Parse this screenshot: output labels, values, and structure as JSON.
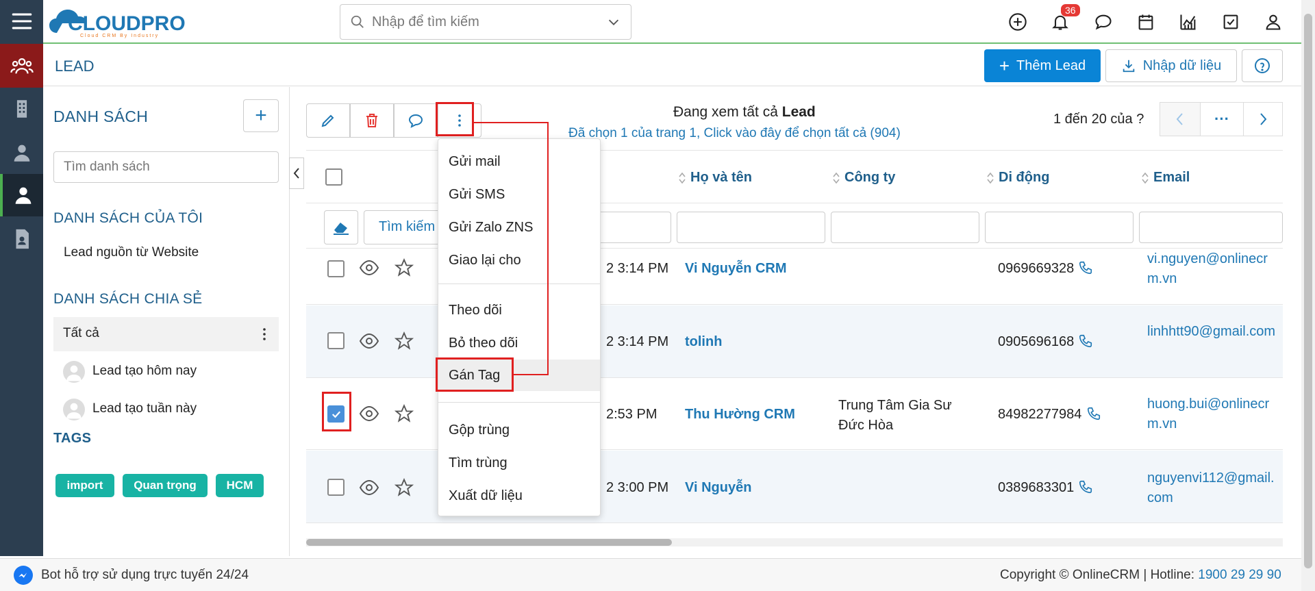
{
  "app": {
    "logo_text": "CLOUDPRO",
    "logo_tagline": "Cloud CRM By Industry"
  },
  "search": {
    "placeholder": "Nhập để tìm kiếm"
  },
  "notifications": {
    "count": "36"
  },
  "module": {
    "title": "LEAD",
    "add_button": "Thêm Lead",
    "import_button": "Nhập dữ liệu"
  },
  "lists": {
    "header": "DANH SÁCH",
    "search_placeholder": "Tìm danh sách",
    "my_lists_header": "DANH SÁCH CỦA TÔI",
    "my_lists": [
      "Lead nguồn từ Website"
    ],
    "shared_header": "DANH SÁCH CHIA SẺ",
    "shared": [
      "Tất cả",
      "Lead tạo hôm nay",
      "Lead tạo tuần này"
    ],
    "tags_header": "TAGS",
    "tags": [
      "import",
      "Quan trọng",
      "HCM"
    ]
  },
  "view": {
    "viewing_prefix": "Đang xem tất cả",
    "viewing_entity": "Lead",
    "selection_note": "Đã chọn 1 của trang 1, Click vào đây để chọn tất cả (904)",
    "pagination": "1 đến 20 của",
    "pagination_unknown": "?",
    "more_pages": "···"
  },
  "table": {
    "filter_button": "Tìm kiếm",
    "columns": [
      "Họ và tên",
      "Công ty",
      "Di động",
      "Email"
    ],
    "rows": [
      {
        "time": "2 3:14 PM",
        "name": "Vi Nguyễn CRM",
        "company": "",
        "mobile": "0969669328",
        "email": "vi.nguyen@onlinecrm.vn",
        "checked": false
      },
      {
        "time": "2 3:14 PM",
        "name": "tolinh",
        "company": "",
        "mobile": "0905696168",
        "email": "linhhtt90@gmail.com",
        "checked": false
      },
      {
        "time": "2:53 PM",
        "name": "Thu Hường CRM",
        "company": "Trung Tâm Gia Sư Đức Hòa",
        "mobile": "84982277984",
        "email": "huong.bui@onlinecrm.vn",
        "checked": true
      },
      {
        "time": "2 3:00 PM",
        "name": "Vi Nguyễn",
        "company": "",
        "mobile": "0389683301",
        "email": "nguyenvi112@gmail.com",
        "checked": false
      }
    ]
  },
  "actions_menu": {
    "items": [
      "Gửi mail",
      "Gửi SMS",
      "Gửi Zalo ZNS",
      "Giao lại cho",
      "Theo dõi",
      "Bỏ theo dõi",
      "Gán Tag",
      "Gộp trùng",
      "Tìm trùng",
      "Xuất dữ liệu"
    ],
    "highlighted": "Gán Tag"
  },
  "footer": {
    "bot_text": "Bot hỗ trợ sử dụng trực tuyến 24/24",
    "copyright": "Copyright © OnlineCRM",
    "hotline_label": "Hotline:",
    "hotline_number": "1900 29 29 90"
  },
  "colors": {
    "accent": "#0a84d6",
    "brand_dark": "#2c3e50",
    "tag": "#18b3a4",
    "highlight_red": "#e02020",
    "active_rail": "#8b1a1a"
  }
}
